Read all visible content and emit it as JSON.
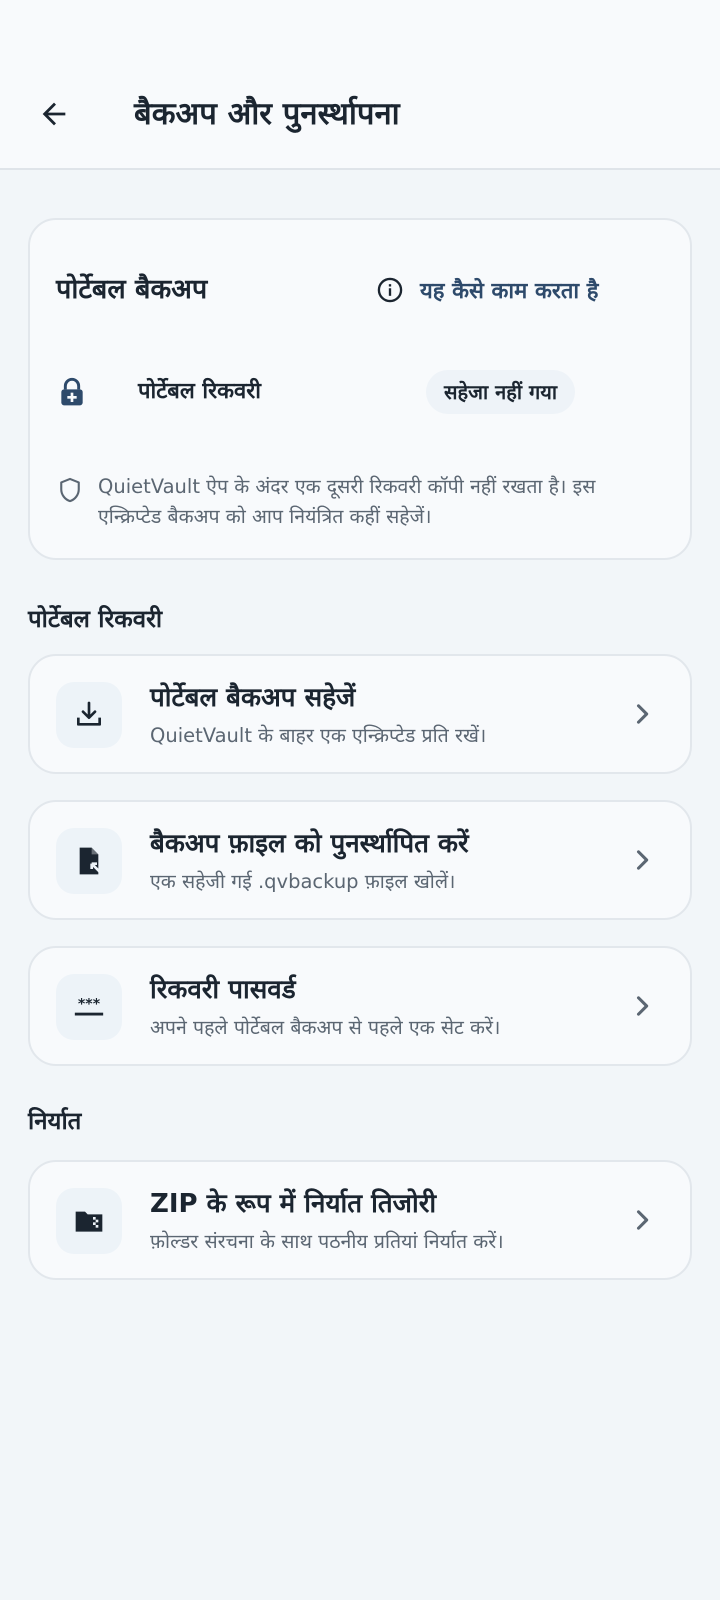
{
  "app_bar": {
    "title": "बैकअप और पुनर्स्थापना"
  },
  "status_card": {
    "title": "पोर्टेबल बैकअप",
    "help_link": "यह कैसे काम करता है",
    "recovery_label": "पोर्टेबल रिकवरी",
    "recovery_status": "सहेजा नहीं गया",
    "note": "QuietVault ऐप के अंदर एक दूसरी रिकवरी कॉपी नहीं रखता है। इस एन्क्रिप्टेड बैकअप को आप नियंत्रित कहीं सहेजें।"
  },
  "sections": {
    "portable_recovery": "पोर्टेबल रिकवरी",
    "export": "निर्यात"
  },
  "actions": [
    {
      "title": "पोर्टेबल बैकअप सहेजें",
      "subtitle": "QuietVault के बाहर एक एन्क्रिप्टेड प्रति रखें।",
      "icon": "download-icon"
    },
    {
      "title": "बैकअप फ़ाइल को पुनर्स्थापित करें",
      "subtitle": "एक सहेजी गई .qvbackup फ़ाइल खोलें।",
      "icon": "file-restore-icon"
    },
    {
      "title": "रिकवरी पासवर्ड",
      "subtitle": "अपने पहले पोर्टेबल बैकअप से पहले एक सेट करें।",
      "icon": "password-icon"
    },
    {
      "title": "ZIP के रूप में निर्यात तिजोरी",
      "subtitle": "फ़ोल्डर संरचना के साथ पठनीय प्रतियां निर्यात करें।",
      "icon": "zip-folder-icon"
    }
  ]
}
